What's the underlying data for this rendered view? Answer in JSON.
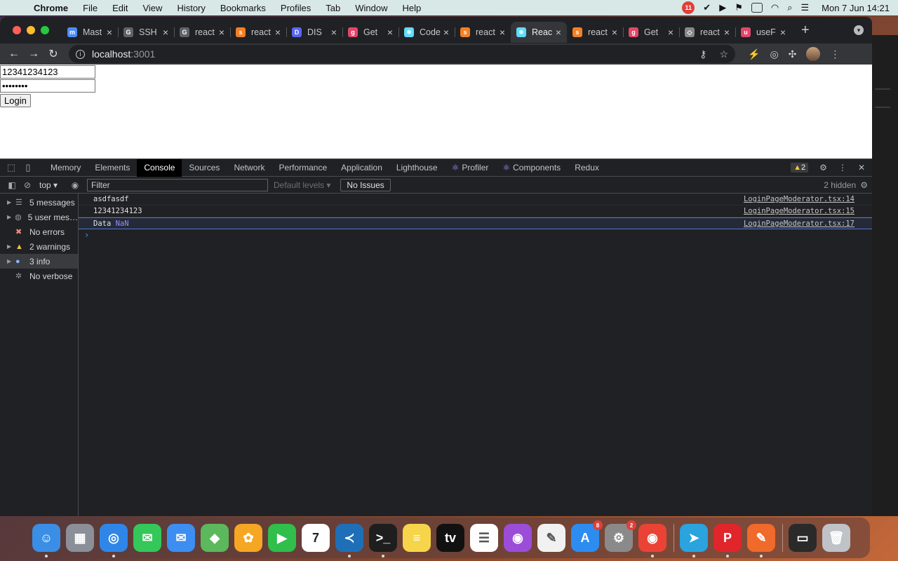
{
  "menubar": {
    "app": "Chrome",
    "items": [
      "File",
      "Edit",
      "View",
      "History",
      "Bookmarks",
      "Profiles",
      "Tab",
      "Window",
      "Help"
    ],
    "notif_count": "11",
    "clock": "Mon 7 Jun  14:21"
  },
  "tabs": [
    {
      "title": "Mast",
      "color": "#4c8cf7",
      "glyph": "m"
    },
    {
      "title": "SSH",
      "color": "#5f6368",
      "glyph": "G"
    },
    {
      "title": "react",
      "color": "#5f6368",
      "glyph": "G"
    },
    {
      "title": "react",
      "color": "#f48024",
      "glyph": "s"
    },
    {
      "title": "DIS",
      "color": "#5865f2",
      "glyph": "D"
    },
    {
      "title": "Get",
      "color": "#e2476b",
      "glyph": "g"
    },
    {
      "title": "Code",
      "color": "#61dafb",
      "glyph": "⚛"
    },
    {
      "title": "react",
      "color": "#f48024",
      "glyph": "s"
    },
    {
      "title": "Reac",
      "color": "#61dafb",
      "glyph": "⚛",
      "active": true
    },
    {
      "title": "react",
      "color": "#f48024",
      "glyph": "s"
    },
    {
      "title": "Get",
      "color": "#e2476b",
      "glyph": "g"
    },
    {
      "title": "react",
      "color": "#888888",
      "glyph": "◇"
    },
    {
      "title": "useF",
      "color": "#e2476b",
      "glyph": "u"
    }
  ],
  "address": {
    "host": "localhost",
    "port": ":3001"
  },
  "page": {
    "username_value": "12341234123",
    "password_value": "••••••••",
    "login_label": "Login"
  },
  "devtools": {
    "tabs": [
      "Memory",
      "Elements",
      "Console",
      "Sources",
      "Network",
      "Performance",
      "Application",
      "Lighthouse",
      "Profiler",
      "Components",
      "Redux"
    ],
    "active_tab": "Console",
    "warning_count": "2",
    "context": "top",
    "filter_placeholder": "Filter",
    "levels": "Default levels",
    "issues": "No Issues",
    "hidden": "2 hidden",
    "sidebar": [
      {
        "label": "5 messages",
        "icon": "list-icon",
        "expandable": true
      },
      {
        "label": "5 user mes…",
        "icon": "user-icon",
        "expandable": true
      },
      {
        "label": "No errors",
        "icon": "error-icon",
        "expandable": false
      },
      {
        "label": "2 warnings",
        "icon": "warning-icon",
        "expandable": true
      },
      {
        "label": "3 info",
        "icon": "info-icon",
        "expandable": true,
        "selected": true
      },
      {
        "label": "No verbose",
        "icon": "verbose-icon",
        "expandable": false
      }
    ],
    "messages": [
      {
        "text": "asdfasdf",
        "value": "",
        "source": "LoginPageModerator.tsx:14"
      },
      {
        "text": "12341234123",
        "value": "",
        "source": "LoginPageModerator.tsx:15"
      },
      {
        "text": "Data ",
        "value": "NaN",
        "source": "LoginPageModerator.tsx:17",
        "selected": true
      }
    ]
  },
  "dock": [
    {
      "name": "finder",
      "color": "#3a8ee6",
      "glyph": "☺",
      "running": true
    },
    {
      "name": "launchpad",
      "color": "#8a8f98",
      "glyph": "▦"
    },
    {
      "name": "safari",
      "color": "#2f86e8",
      "glyph": "◎",
      "running": true
    },
    {
      "name": "messages",
      "color": "#34c759",
      "glyph": "✉"
    },
    {
      "name": "mail",
      "color": "#3d8ef0",
      "glyph": "✉"
    },
    {
      "name": "maps",
      "color": "#5cb85c",
      "glyph": "◆"
    },
    {
      "name": "photos",
      "color": "#f5a623",
      "glyph": "✿"
    },
    {
      "name": "facetime",
      "color": "#2fbf4a",
      "glyph": "▶"
    },
    {
      "name": "calendar",
      "color": "#ffffff",
      "glyph": "7",
      "text_color": "#222"
    },
    {
      "name": "vscode",
      "color": "#1f6fb8",
      "glyph": "≺",
      "running": true
    },
    {
      "name": "terminal",
      "color": "#1e1e1e",
      "glyph": ">_",
      "running": true
    },
    {
      "name": "notes",
      "color": "#f7d54a",
      "glyph": "≡"
    },
    {
      "name": "tv",
      "color": "#111111",
      "glyph": "tv"
    },
    {
      "name": "reminders",
      "color": "#ffffff",
      "glyph": "☰",
      "text_color": "#555"
    },
    {
      "name": "podcasts",
      "color": "#9b4dd8",
      "glyph": "◉"
    },
    {
      "name": "textedit",
      "color": "#f1f1f1",
      "glyph": "✎",
      "text_color": "#555"
    },
    {
      "name": "app-store",
      "color": "#2d8cf0",
      "glyph": "A",
      "badge": "8"
    },
    {
      "name": "system-preferences",
      "color": "#8a8a8a",
      "glyph": "⚙",
      "badge": "2"
    },
    {
      "name": "chrome",
      "color": "#ea4335",
      "glyph": "◉",
      "running": true
    },
    {
      "name": "telegram",
      "color": "#2aa3df",
      "glyph": "➤",
      "running": true
    },
    {
      "name": "pdf-reader",
      "color": "#e0262b",
      "glyph": "P",
      "running": true
    },
    {
      "name": "postman",
      "color": "#ef6a2b",
      "glyph": "✎",
      "running": true
    },
    {
      "name": "minimized-window",
      "color": "#2a2a2a",
      "glyph": "▭"
    },
    {
      "name": "trash",
      "color": "#bfc3c7",
      "glyph": "🗑"
    }
  ]
}
